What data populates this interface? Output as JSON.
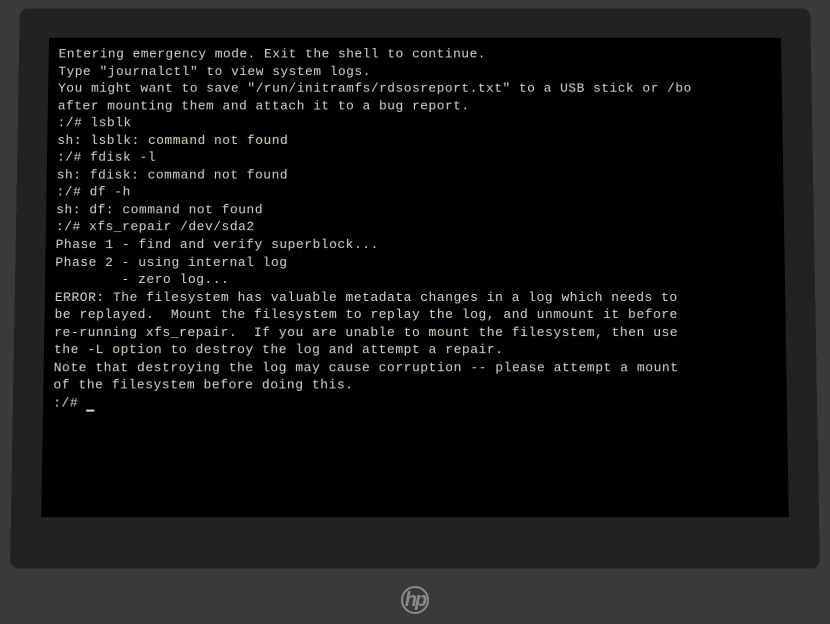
{
  "terminal": {
    "lines": [
      "Entering emergency mode. Exit the shell to continue.",
      "Type \"journalctl\" to view system logs.",
      "You might want to save \"/run/initramfs/rdsosreport.txt\" to a USB stick or /bo",
      "after mounting them and attach it to a bug report.",
      "",
      "",
      ":/# lsblk",
      "sh: lsblk: command not found",
      ":/# fdisk -l",
      "sh: fdisk: command not found",
      ":/# df -h",
      "sh: df: command not found",
      ":/# xfs_repair /dev/sda2",
      "Phase 1 - find and verify superblock...",
      "Phase 2 - using internal log",
      "        - zero log...",
      "ERROR: The filesystem has valuable metadata changes in a log which needs to",
      "be replayed.  Mount the filesystem to replay the log, and unmount it before",
      "re-running xfs_repair.  If you are unable to mount the filesystem, then use",
      "the -L option to destroy the log and attempt a repair.",
      "Note that destroying the log may cause corruption -- please attempt a mount",
      "of the filesystem before doing this.",
      ":/# "
    ]
  },
  "logo": {
    "text": "hp"
  }
}
